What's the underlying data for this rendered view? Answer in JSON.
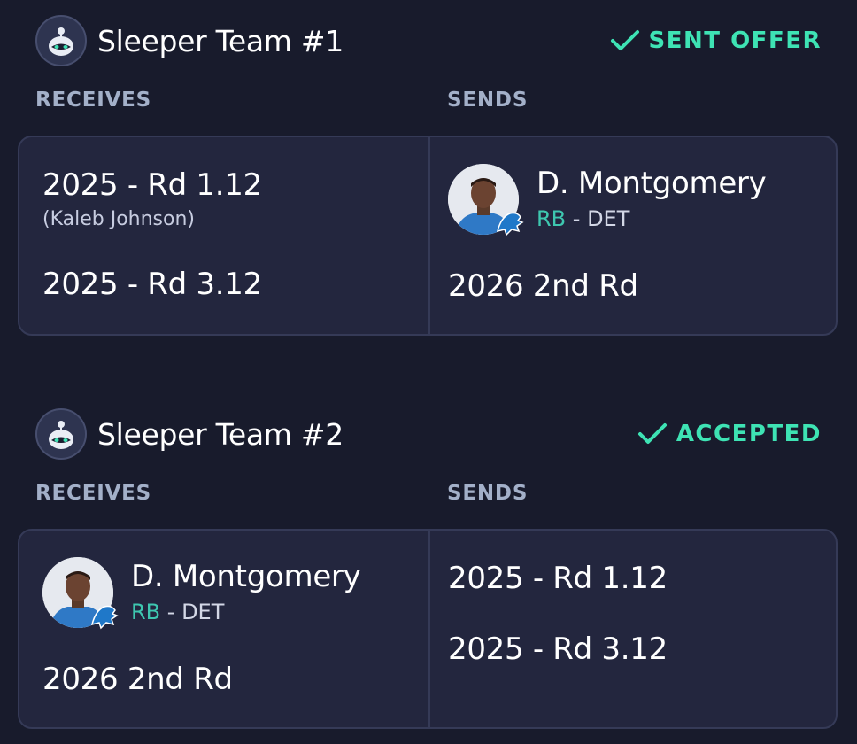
{
  "trades": [
    {
      "team_name": "Sleeper Team #1",
      "status": "SENT OFFER",
      "receives_label": "RECEIVES",
      "sends_label": "SENDS",
      "receives": [
        {
          "pick": "2025 - Rd 1.12",
          "note": "(Kaleb Johnson)"
        },
        {
          "pick": "2025 - Rd 3.12"
        }
      ],
      "sends": [
        {
          "player": "D. Montgomery",
          "position": "RB",
          "team": "- DET"
        },
        {
          "pick": "2026 2nd Rd"
        }
      ]
    },
    {
      "team_name": "Sleeper Team #2",
      "status": "ACCEPTED",
      "receives_label": "RECEIVES",
      "sends_label": "SENDS",
      "receives": [
        {
          "player": "D. Montgomery",
          "position": "RB",
          "team": "- DET"
        },
        {
          "pick": "2026 2nd Rd"
        }
      ],
      "sends": [
        {
          "pick": "2025 - Rd 1.12"
        },
        {
          "pick": "2025 - Rd 3.12"
        }
      ]
    }
  ],
  "colors": {
    "background": "#181b2c",
    "card": "#23263e",
    "accent_green": "#3ee3b4",
    "position_teal": "#3ec7b0",
    "label_gray": "#a3b0c9"
  },
  "icons": {
    "team_avatar": "sleeper-robot-icon",
    "status": "check-icon",
    "team_logo": "detroit-lions-logo-icon"
  }
}
